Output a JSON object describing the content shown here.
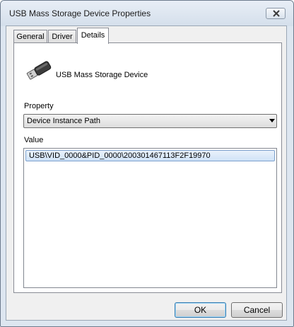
{
  "window": {
    "title": "USB Mass Storage Device Properties"
  },
  "tabs": [
    {
      "label": "General"
    },
    {
      "label": "Driver"
    },
    {
      "label": "Details"
    }
  ],
  "active_tab": "Details",
  "device": {
    "name": "USB Mass Storage Device",
    "icon": "usb-plug-icon"
  },
  "property": {
    "label": "Property",
    "selected": "Device Instance Path"
  },
  "value": {
    "label": "Value",
    "items": [
      "USB\\VID_0000&PID_0000\\200301467113F2F19970"
    ]
  },
  "buttons": {
    "ok": "OK",
    "cancel": "Cancel"
  }
}
